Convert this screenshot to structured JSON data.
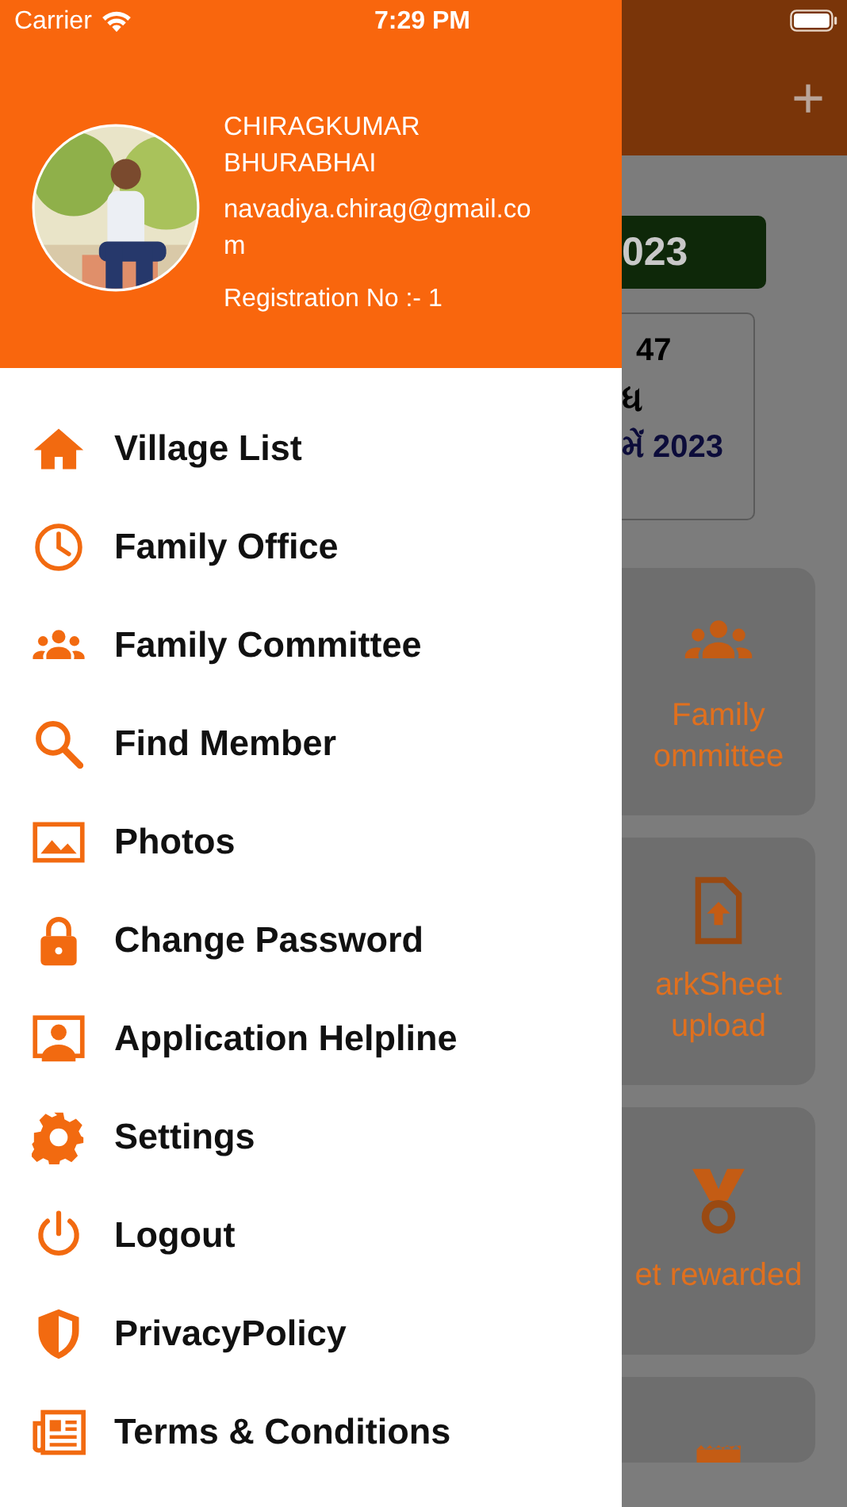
{
  "status_bar": {
    "carrier": "Carrier",
    "time": "7:29 PM"
  },
  "profile": {
    "name": "CHIRAGKUMAR BHURABHAI",
    "email": "navadiya.chirag@gmail.com",
    "registration": "Registration No :- 1"
  },
  "menu": [
    {
      "label": "Village List"
    },
    {
      "label": "Family Office"
    },
    {
      "label": "Family Committee"
    },
    {
      "label": "Find Member"
    },
    {
      "label": "Photos"
    },
    {
      "label": "Change Password"
    },
    {
      "label": "Application Helpline"
    },
    {
      "label": "Settings"
    },
    {
      "label": "Logout"
    },
    {
      "label": "PrivacyPolicy"
    },
    {
      "label": "Terms & Conditions"
    }
  ],
  "background": {
    "add_button": "+",
    "year_banner": "023",
    "notice": [
      "47",
      "ધ",
      "મેં 2023"
    ],
    "tiles": [
      {
        "kind": "labelled",
        "lines": [
          "Family",
          "ommittee"
        ]
      },
      {
        "kind": "labelled",
        "lines": [
          "arkSheet",
          "upload"
        ]
      },
      {
        "kind": "labelled",
        "lines": [
          "et rewarded"
        ]
      },
      {
        "kind": "cut"
      }
    ]
  }
}
